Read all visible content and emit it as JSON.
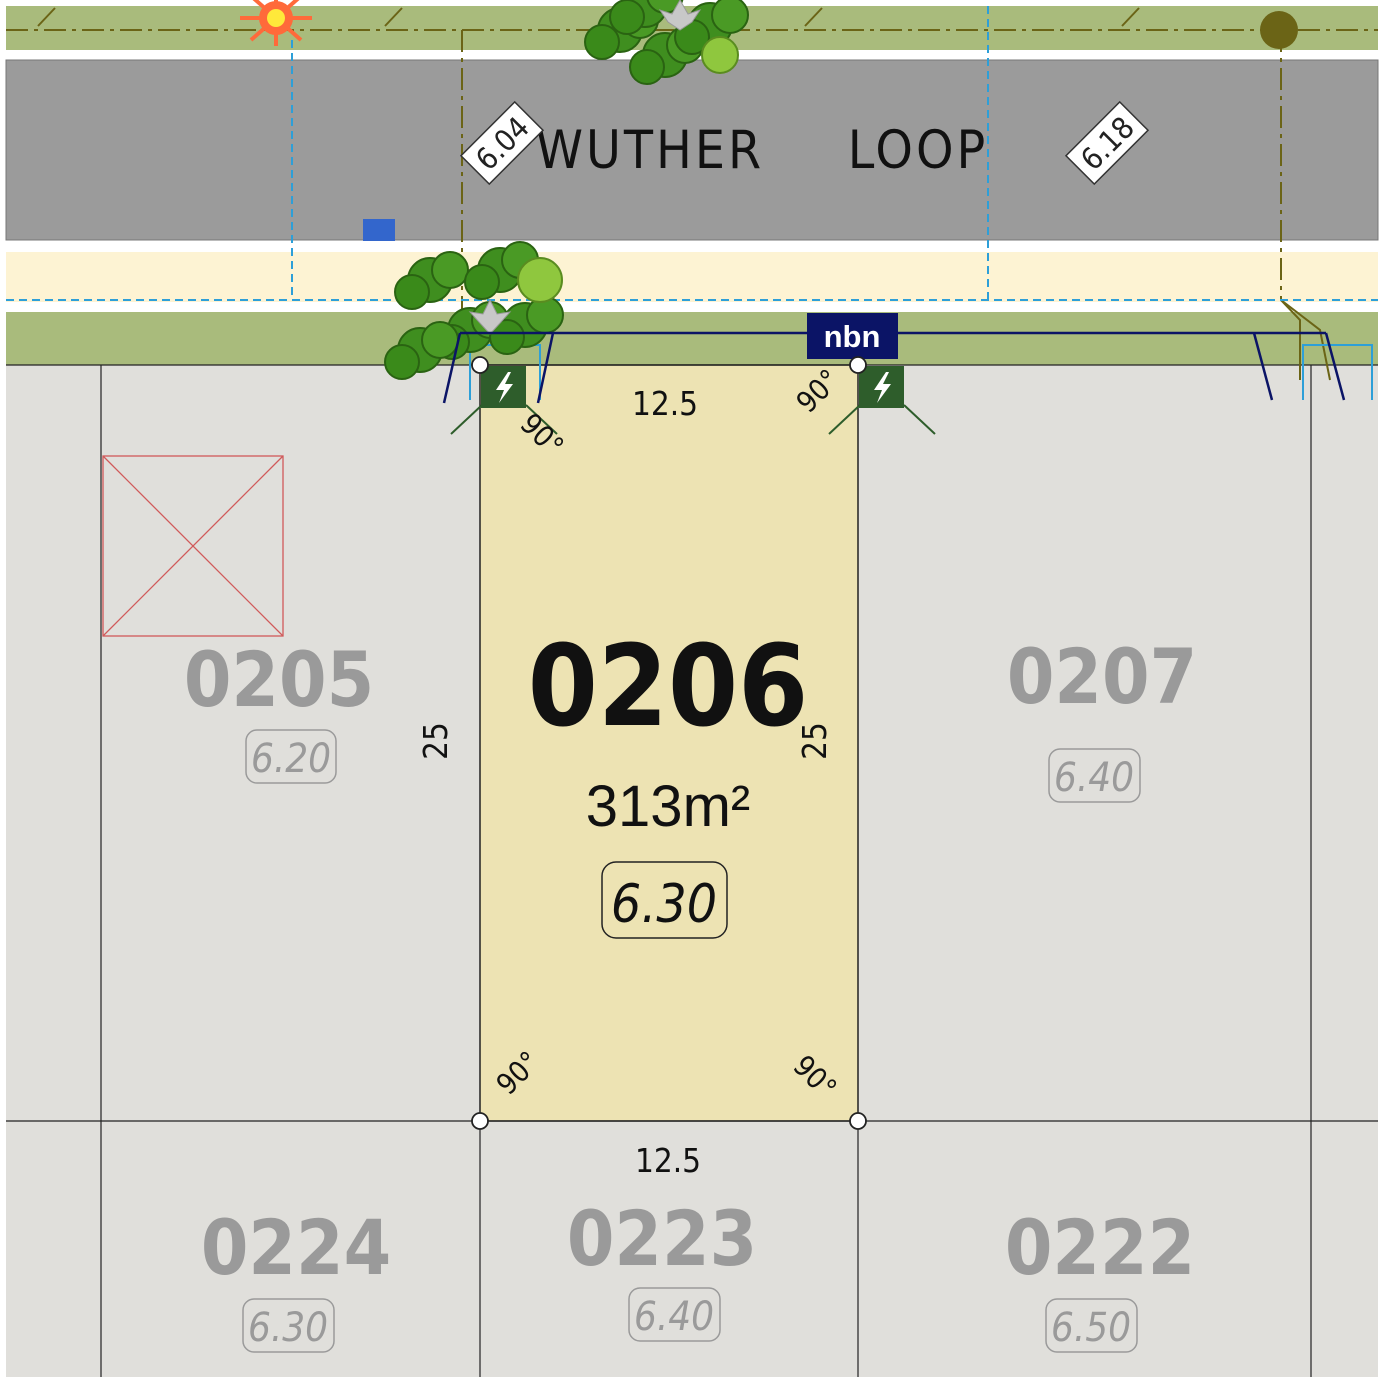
{
  "road": {
    "name_part1": "WUTHER",
    "name_part2": "LOOP",
    "levels": [
      "6.04",
      "6.18"
    ]
  },
  "service": {
    "nbn_label": "nbn"
  },
  "feature_lot": {
    "number": "0206",
    "area": "313m²",
    "level": "6.30",
    "frontage": "12.5",
    "rear": "12.5",
    "left_depth": "25",
    "right_depth": "25",
    "angles": [
      "90°",
      "90°",
      "90°",
      "90°"
    ]
  },
  "neighbour_lots": [
    {
      "number": "0205",
      "level": "6.20"
    },
    {
      "number": "0207",
      "level": "6.40"
    },
    {
      "number": "0224",
      "level": "6.30"
    },
    {
      "number": "0223",
      "level": "6.40"
    },
    {
      "number": "0222",
      "level": "6.50"
    }
  ],
  "colors": {
    "road": "#9b9b9b",
    "verge": "#a9bb7c",
    "footpath": "#fdf3d3",
    "feature_lot": "#ede3b3",
    "neighbour_lot": "#e0dfdb",
    "neighbour_text": "#9a9a9a",
    "nbn": "#0b1466",
    "power_pit": "#2e5d2b",
    "sewer_line": "#6b6416",
    "water_line": "#2d9fd8"
  }
}
